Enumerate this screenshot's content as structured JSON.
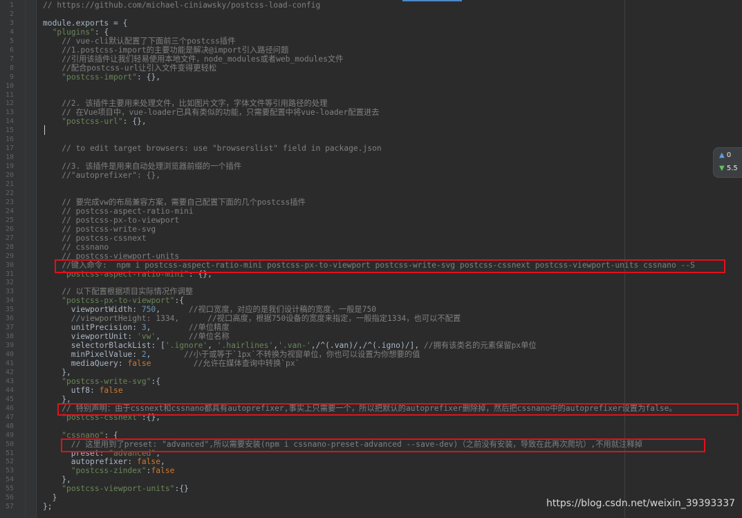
{
  "editor": {
    "line_numbers": [
      "1",
      "2",
      "3",
      "4",
      "5",
      "6",
      "7",
      "8",
      "9",
      "10",
      "11",
      "12",
      "13",
      "14",
      "15",
      "16",
      "17",
      "18",
      "19",
      "20",
      "21",
      "22",
      "23",
      "24",
      "25",
      "26",
      "27",
      "28",
      "29",
      "30",
      "31",
      "32",
      "33",
      "34",
      "35",
      "36",
      "37",
      "38",
      "39",
      "40",
      "41",
      "42",
      "43",
      "44",
      "45",
      "46",
      "47",
      "48",
      "49",
      "50",
      "51",
      "52",
      "53",
      "54",
      "55",
      "56",
      "57"
    ],
    "lines": [
      {
        "segments": [
          {
            "cls": "c-comment",
            "text": "// https://github.com/michael-ciniawsky/postcss-load-config"
          }
        ]
      },
      {
        "segments": []
      },
      {
        "segments": [
          {
            "cls": "c-default",
            "text": "module.exports = {"
          }
        ]
      },
      {
        "segments": [
          {
            "cls": "c-default",
            "text": "  "
          },
          {
            "cls": "c-key",
            "text": "\"plugins\""
          },
          {
            "cls": "c-default",
            "text": ": {"
          }
        ]
      },
      {
        "segments": [
          {
            "cls": "c-comment",
            "text": "    // vue-cli默认配置了下面前三个postcss插件"
          }
        ]
      },
      {
        "segments": [
          {
            "cls": "c-comment",
            "text": "    //1.postcss-import的主要功能是解决@import引入路径问题"
          }
        ]
      },
      {
        "segments": [
          {
            "cls": "c-comment",
            "text": "    //引用该插件让我们轻易使用本地文件，node_modules或者web_modules文件"
          }
        ]
      },
      {
        "segments": [
          {
            "cls": "c-comment",
            "text": "    //配合postcss-url让引入文件变得更轻松"
          }
        ]
      },
      {
        "segments": [
          {
            "cls": "c-default",
            "text": "    "
          },
          {
            "cls": "c-key",
            "text": "\"postcss-import\""
          },
          {
            "cls": "c-default",
            "text": ": {},"
          }
        ]
      },
      {
        "segments": []
      },
      {
        "segments": []
      },
      {
        "segments": [
          {
            "cls": "c-comment",
            "text": "    //2. 该插件主要用来处理文件，比如图片文字，字体文件等引用路径的处理"
          }
        ]
      },
      {
        "segments": [
          {
            "cls": "c-comment",
            "text": "    // 在Vue项目中，vue-loader已具有类似的功能，只需要配置中将vue-loader配置进去"
          }
        ]
      },
      {
        "segments": [
          {
            "cls": "c-default",
            "text": "    "
          },
          {
            "cls": "c-key",
            "text": "\"postcss-url\""
          },
          {
            "cls": "c-default",
            "text": ": {},"
          }
        ]
      },
      {
        "segments": []
      },
      {
        "segments": []
      },
      {
        "segments": [
          {
            "cls": "c-comment",
            "text": "    // to edit target browsers: use \"browserslist\" field in package.json"
          }
        ]
      },
      {
        "segments": []
      },
      {
        "segments": [
          {
            "cls": "c-comment",
            "text": "    //3. 该插件是用来自动处理浏览器前缀的一个插件"
          }
        ]
      },
      {
        "segments": [
          {
            "cls": "c-comment",
            "text": "    //\"autoprefixer\": {},"
          }
        ]
      },
      {
        "segments": []
      },
      {
        "segments": []
      },
      {
        "segments": [
          {
            "cls": "c-comment",
            "text": "    // 要完成vw的布局兼容方案，需要自己配置下面的几个postcss插件"
          }
        ]
      },
      {
        "segments": [
          {
            "cls": "c-comment",
            "text": "    // postcss-aspect-ratio-mini"
          }
        ]
      },
      {
        "segments": [
          {
            "cls": "c-comment",
            "text": "    // postcss-px-to-viewport"
          }
        ]
      },
      {
        "segments": [
          {
            "cls": "c-comment",
            "text": "    // postcss-write-svg"
          }
        ]
      },
      {
        "segments": [
          {
            "cls": "c-comment",
            "text": "    // postcss-cssnext"
          }
        ]
      },
      {
        "segments": [
          {
            "cls": "c-comment",
            "text": "    // cssnano"
          }
        ]
      },
      {
        "segments": [
          {
            "cls": "c-comment",
            "text": "    // postcss-viewport-units"
          }
        ]
      },
      {
        "segments": [
          {
            "cls": "c-comment",
            "text": "    //键入命令:  npm i postcss-aspect-ratio-mini postcss-px-to-viewport postcss-write-svg postcss-cssnext postcss-viewport-units cssnano --S"
          }
        ]
      },
      {
        "segments": [
          {
            "cls": "c-default",
            "text": "    "
          },
          {
            "cls": "c-key",
            "text": "\"postcss-aspect-ratio-mini\""
          },
          {
            "cls": "c-default",
            "text": ": {},"
          }
        ]
      },
      {
        "segments": []
      },
      {
        "segments": [
          {
            "cls": "c-comment",
            "text": "    // 以下配置根据项目实际情况作调整"
          }
        ]
      },
      {
        "segments": [
          {
            "cls": "c-default",
            "text": "    "
          },
          {
            "cls": "c-key",
            "text": "\"postcss-px-to-viewport\""
          },
          {
            "cls": "c-default",
            "text": ":{"
          }
        ]
      },
      {
        "segments": [
          {
            "cls": "c-default",
            "text": "      viewportWidth: "
          },
          {
            "cls": "c-number",
            "text": "750"
          },
          {
            "cls": "c-default",
            "text": ",      "
          },
          {
            "cls": "c-comment",
            "text": "//视口宽度，对应的是我们设计稿的宽度，一般是750"
          }
        ]
      },
      {
        "segments": [
          {
            "cls": "c-comment",
            "text": "      //viewportHeight: 1334,      //视口高度，根据750设备的宽度来指定，一般指定1334，也可以不配置"
          }
        ]
      },
      {
        "segments": [
          {
            "cls": "c-default",
            "text": "      unitPrecision: "
          },
          {
            "cls": "c-number",
            "text": "3"
          },
          {
            "cls": "c-default",
            "text": ",        "
          },
          {
            "cls": "c-comment",
            "text": "//单位精度"
          }
        ]
      },
      {
        "segments": [
          {
            "cls": "c-default",
            "text": "      viewportUnit: "
          },
          {
            "cls": "c-key",
            "text": "'vw'"
          },
          {
            "cls": "c-default",
            "text": ",      "
          },
          {
            "cls": "c-comment",
            "text": "//单位名称"
          }
        ]
      },
      {
        "segments": [
          {
            "cls": "c-default",
            "text": "      selectorBlackList: ["
          },
          {
            "cls": "c-key",
            "text": "'.ignore'"
          },
          {
            "cls": "c-default",
            "text": ", "
          },
          {
            "cls": "c-key",
            "text": "'.hairlines'"
          },
          {
            "cls": "c-default",
            "text": ","
          },
          {
            "cls": "c-key",
            "text": "'.van-'"
          },
          {
            "cls": "c-default",
            "text": ",/^(.van)/,/^(.igno)/], "
          },
          {
            "cls": "c-comment",
            "text": "//拥有该类名的元素保留px单位"
          }
        ]
      },
      {
        "segments": [
          {
            "cls": "c-default",
            "text": "      minPixelValue: "
          },
          {
            "cls": "c-number",
            "text": "2"
          },
          {
            "cls": "c-default",
            "text": ",       "
          },
          {
            "cls": "c-comment",
            "text": "//小于或等于`1px`不转换为视窗单位，你也可以设置为你想要的值"
          }
        ]
      },
      {
        "segments": [
          {
            "cls": "c-default",
            "text": "      mediaQuery: "
          },
          {
            "cls": "c-kw",
            "text": "false"
          },
          {
            "cls": "c-default",
            "text": "         "
          },
          {
            "cls": "c-comment",
            "text": "//允许在媒体查询中转换`px`"
          }
        ]
      },
      {
        "segments": [
          {
            "cls": "c-default",
            "text": "    },"
          }
        ]
      },
      {
        "segments": [
          {
            "cls": "c-default",
            "text": "    "
          },
          {
            "cls": "c-key",
            "text": "\"postcss-write-svg\""
          },
          {
            "cls": "c-default",
            "text": ":{"
          }
        ]
      },
      {
        "segments": [
          {
            "cls": "c-default",
            "text": "      utf8: "
          },
          {
            "cls": "c-kw",
            "text": "false"
          }
        ]
      },
      {
        "segments": [
          {
            "cls": "c-default",
            "text": "    },"
          }
        ]
      },
      {
        "segments": [
          {
            "cls": "c-comment",
            "text": "    // 特别声明：由于cssnext和cssnano都具有autoprefixer,事实上只需要一个，所以把默认的autoprefixer删除掉，然后把cssnano中的autoprefixer设置为false。"
          }
        ]
      },
      {
        "segments": [
          {
            "cls": "c-default",
            "text": "    "
          },
          {
            "cls": "c-key",
            "text": "\"postcss-cssnext\""
          },
          {
            "cls": "c-default",
            "text": ":{},"
          }
        ]
      },
      {
        "segments": []
      },
      {
        "segments": [
          {
            "cls": "c-default",
            "text": "    "
          },
          {
            "cls": "c-key",
            "text": "\"cssnano\""
          },
          {
            "cls": "c-default",
            "text": ": {"
          }
        ]
      },
      {
        "segments": [
          {
            "cls": "c-comment",
            "text": "      // 这里用到了preset: \"advanced\",所以需要安装(npm i cssnano-preset-advanced --save-dev)（之前没有安装，导致在此再次爬坑）,不用就注释掉"
          }
        ]
      },
      {
        "segments": [
          {
            "cls": "c-default",
            "text": "      preset: "
          },
          {
            "cls": "c-key",
            "text": "\"advanced\""
          },
          {
            "cls": "c-default",
            "text": ","
          }
        ]
      },
      {
        "segments": [
          {
            "cls": "c-default",
            "text": "      autoprefixer: "
          },
          {
            "cls": "c-kw",
            "text": "false"
          },
          {
            "cls": "c-default",
            "text": ","
          }
        ]
      },
      {
        "segments": [
          {
            "cls": "c-default",
            "text": "      "
          },
          {
            "cls": "c-key",
            "text": "\"postcss-zindex\""
          },
          {
            "cls": "c-default",
            "text": ":"
          },
          {
            "cls": "c-kw",
            "text": "false"
          }
        ]
      },
      {
        "segments": [
          {
            "cls": "c-default",
            "text": "    },"
          }
        ]
      },
      {
        "segments": [
          {
            "cls": "c-default",
            "text": "    "
          },
          {
            "cls": "c-key",
            "text": "\"postcss-viewport-units\""
          },
          {
            "cls": "c-default",
            "text": ":{}"
          }
        ]
      },
      {
        "segments": [
          {
            "cls": "c-default",
            "text": "  }"
          }
        ]
      },
      {
        "segments": [
          {
            "cls": "c-default",
            "text": "};"
          }
        ]
      }
    ]
  },
  "highlight_color": "#e3101a",
  "status_widget": {
    "up_icon": "arrow-up-icon",
    "down_icon": "arrow-down-icon",
    "up_value": "0",
    "down_value": "5.5"
  },
  "watermark": "https://blog.csdn.net/weixin_39393337"
}
